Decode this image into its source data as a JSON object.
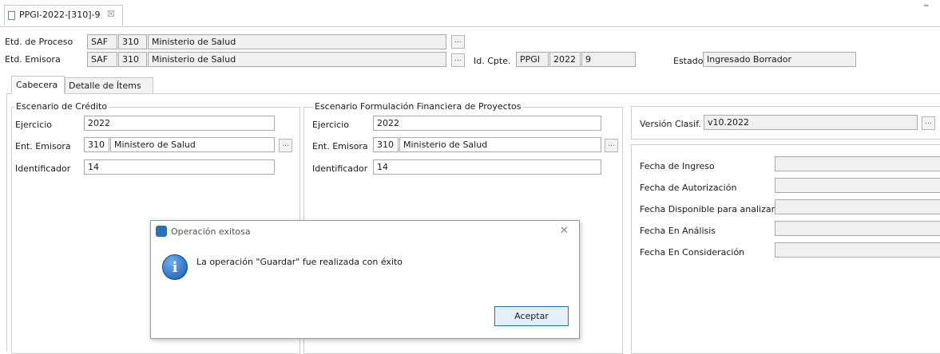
{
  "window": {
    "title": "PPGI-2022-[310]-9",
    "close_glyph": "☒",
    "min_glyph": "═"
  },
  "header": {
    "proceso_label": "Etd. de Proceso",
    "proceso_code": "SAF",
    "proceso_num": "310",
    "proceso_name": "Ministerio de Salud",
    "emisora_label": "Etd. Emisora",
    "emisora_code": "SAF",
    "emisora_num": "310",
    "emisora_name": "Ministerio de Salud",
    "idcpte_label": "Id. Cpte.",
    "idcpte_code": "PPGI",
    "idcpte_year": "2022",
    "idcpte_num": "9",
    "estado_label": "Estado",
    "estado_value": "Ingresado Borrador",
    "ellipsis": "..."
  },
  "tabs": {
    "cabecera": "Cabecera",
    "detalle": "Detalle de Ítems"
  },
  "credito": {
    "title": "Escenario de Crédito",
    "ejercicio_label": "Ejercicio",
    "ejercicio_value": "2022",
    "ent_label": "Ent. Emisora",
    "ent_num": "310",
    "ent_name": "Ministero de Salud",
    "ident_label": "Identificador",
    "ident_value": "14"
  },
  "formulacion": {
    "title": "Escenario Formulación Financiera de Proyectos",
    "ejercicio_label": "Ejercicio",
    "ejercicio_value": "2022",
    "ent_label": "Ent. Emisora",
    "ent_num": "310",
    "ent_name": "Ministerio de Salud",
    "ident_label": "Identificador",
    "ident_value": "14"
  },
  "right": {
    "version_label": "Versión Clasif.",
    "version_value": "v10.2022",
    "fechas": [
      "Fecha de Ingreso",
      "Fecha de Autorización",
      "Fecha Disponible para analizar",
      "Fecha En Análisis",
      "Fecha En Consideración"
    ]
  },
  "dialog": {
    "title": "Operación exitosa",
    "close": "✕",
    "info_glyph": "i",
    "message": "La operación \"Guardar\" fue realizada con éxito",
    "ok": "Aceptar"
  },
  "colors": {
    "accent": "#1e73c8",
    "border": "#a9a9a9"
  }
}
